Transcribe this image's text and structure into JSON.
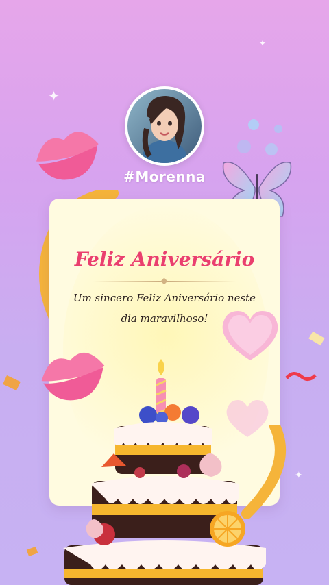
{
  "profile": {
    "username": "#Morenna"
  },
  "card": {
    "title": "Feliz Aniversário",
    "message": "Um sincero Feliz Aniversário neste dia maravilhoso!"
  },
  "decor": {
    "kiss_icon": "lips-kiss-icon",
    "butterfly_icon": "butterfly-icon",
    "heart_icon": "glitter-heart-icon",
    "cake_icon": "birthday-cake-icon"
  },
  "colors": {
    "title": "#ea3f6e",
    "background_top": "#e6a6ea",
    "background_bottom": "#c7b2f3",
    "card": "#fffbe0"
  }
}
